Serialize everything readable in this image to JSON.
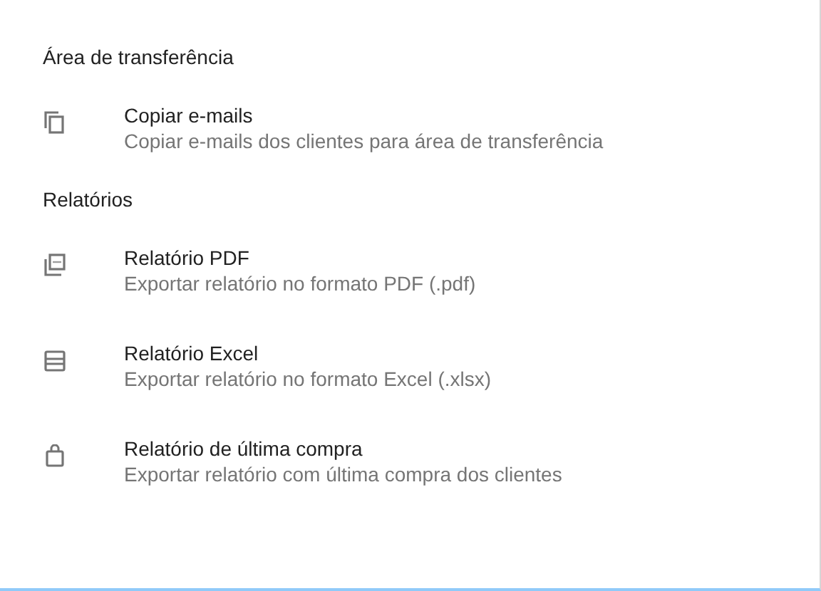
{
  "sections": [
    {
      "title": "Área de transferência",
      "items": [
        {
          "title": "Copiar e-mails",
          "subtitle": "Copiar e-mails dos clientes para área de transferência"
        }
      ]
    },
    {
      "title": "Relatórios",
      "items": [
        {
          "title": "Relatório PDF",
          "subtitle": "Exportar relatório no formato PDF (.pdf)"
        },
        {
          "title": "Relatório Excel",
          "subtitle": "Exportar relatório no formato Excel (.xlsx)"
        },
        {
          "title": "Relatório de última compra",
          "subtitle": "Exportar relatório com última compra dos clientes"
        }
      ]
    }
  ]
}
